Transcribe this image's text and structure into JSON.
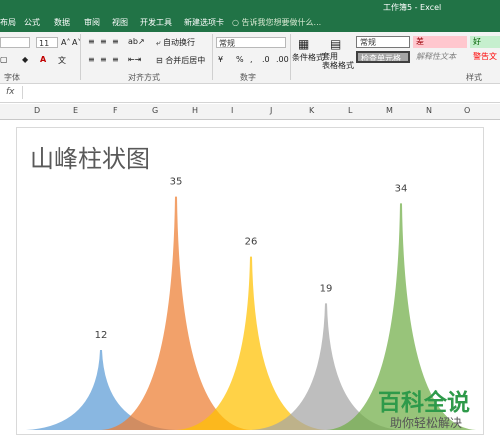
{
  "window": {
    "title": "工作簿5 - Excel",
    "theme_color": "#217346"
  },
  "ribbon_tabs": [
    "布局",
    "公式",
    "数据",
    "审阅",
    "视图",
    "开发工具",
    "新建选项卡"
  ],
  "search_placeholder": "告诉我您想要做什么...",
  "ribbon": {
    "font_size": "11",
    "wrap_text": "自动换行",
    "merge_center": "合并后居中",
    "number_format": "常规",
    "percent": "%",
    "comma": ",",
    "conditional_format": "条件格式",
    "table_format": "套用\n表格格式",
    "groups": {
      "font": "字体",
      "alignment": "对齐方式",
      "number": "数字",
      "styles": "样式"
    },
    "styles": {
      "normal": "常规",
      "bad": "差",
      "good": "好",
      "check_cell": "检查单元格",
      "explanatory": "解释性文本",
      "warning": "警告文"
    }
  },
  "columns": [
    "D",
    "E",
    "F",
    "G",
    "H",
    "I",
    "J",
    "K",
    "L",
    "M",
    "N",
    "O"
  ],
  "chart_data": {
    "type": "bar",
    "title": "山峰柱状图",
    "categories": [
      "",
      "",
      "",
      "",
      ""
    ],
    "values": [
      12,
      35,
      26,
      19,
      34
    ],
    "colors": [
      "#5b9bd5",
      "#ed7d31",
      "#ffc000",
      "#a5a5a5",
      "#70ad47"
    ],
    "data_labels": [
      "12",
      "35",
      "26",
      "19",
      "34"
    ]
  },
  "watermark": {
    "title": "百科全说",
    "subtitle": "助你轻松解决"
  }
}
